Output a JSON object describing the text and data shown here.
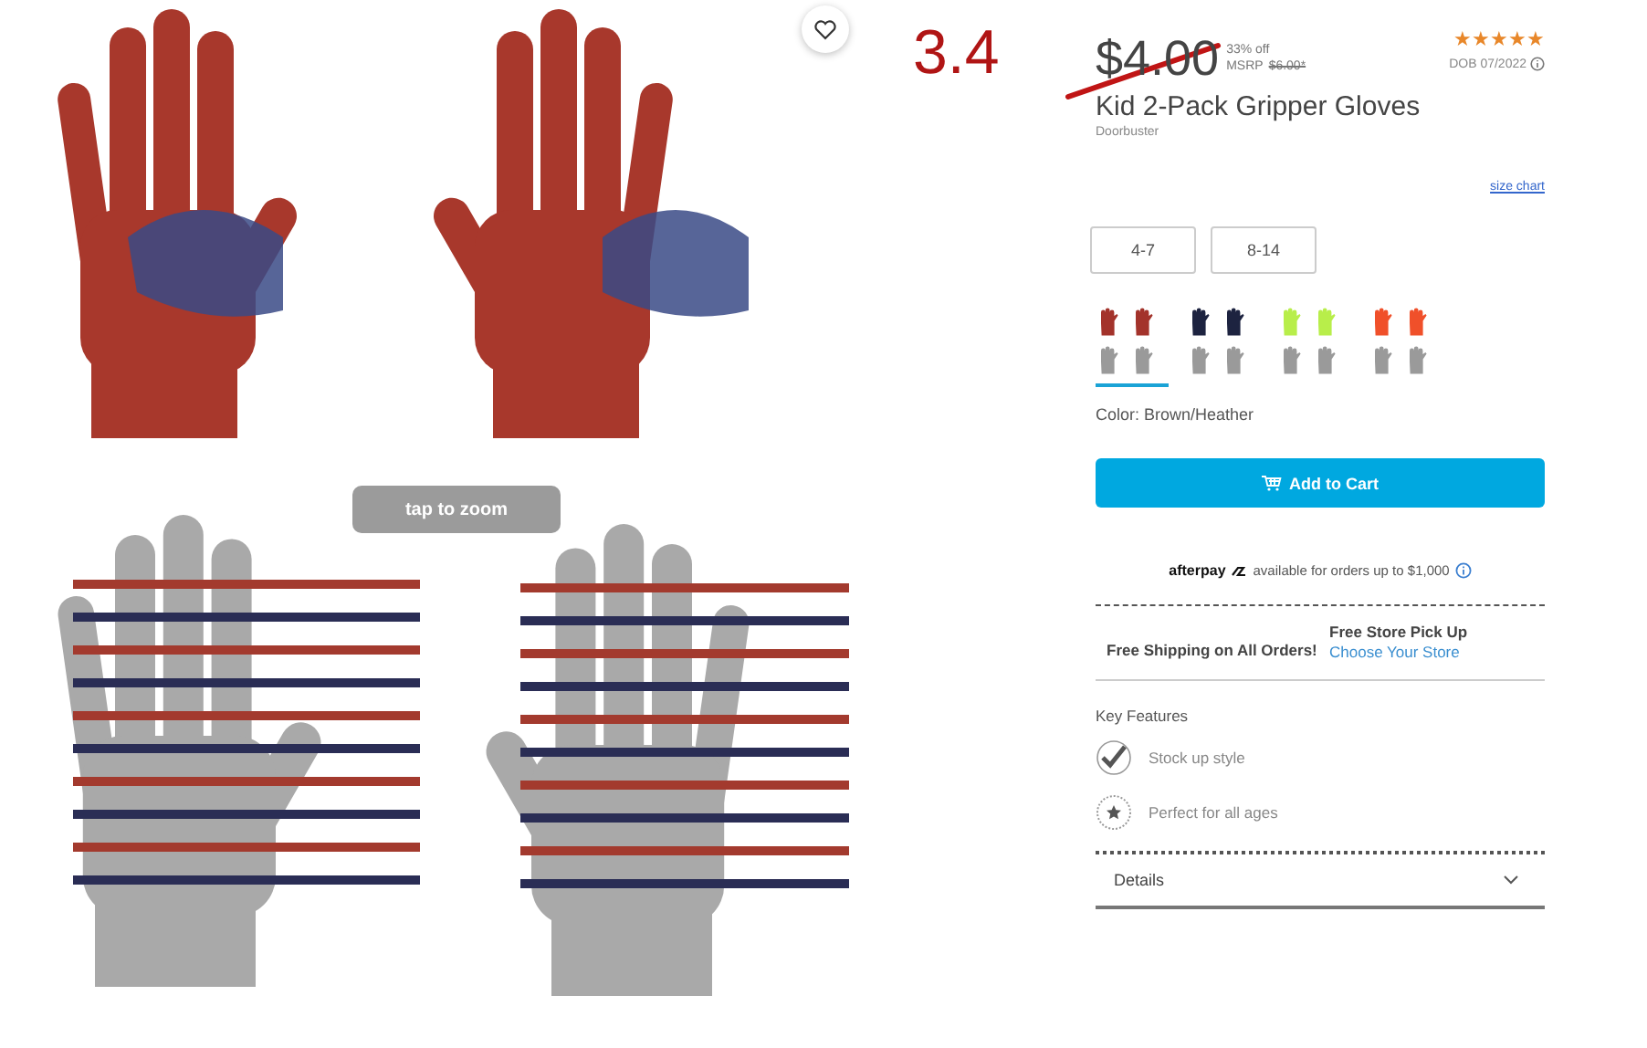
{
  "annotation": {
    "text": "3.4",
    "strike": true
  },
  "gallery": {
    "zoom_hint": "tap to zoom",
    "favorite": false
  },
  "price": {
    "current": "$4.00",
    "discount": "33% off",
    "msrp_label": "MSRP",
    "msrp": "$6.00*"
  },
  "rating": {
    "stars": 5,
    "note": "DOB 07/2022"
  },
  "title": "Kid 2-Pack Gripper Gloves",
  "badge": "Doorbuster",
  "size_chart": "size chart",
  "sizes": [
    {
      "label": "4-7",
      "selected": false
    },
    {
      "label": "8-14",
      "selected": false
    }
  ],
  "swatches": [
    {
      "color": "#a3332b",
      "selected": true
    },
    {
      "color": "#1d2340",
      "selected": false
    },
    {
      "color": "#b8ee4a",
      "selected": false
    },
    {
      "color": "#f0502a",
      "selected": false
    }
  ],
  "color_label": "Color: Brown/Heather",
  "add_to_cart": "Add to Cart",
  "afterpay": {
    "brand": "afterpay",
    "text": "available for orders up to $1,000"
  },
  "shipping": {
    "free_shipping": "Free Shipping on All Orders!",
    "pickup_title": "Free Store Pick Up",
    "pickup_link": "Choose Your Store"
  },
  "key_features": {
    "heading": "Key Features",
    "items": [
      {
        "kind": "check",
        "text": "Stock up style"
      },
      {
        "kind": "star",
        "text": "Perfect for all ages"
      }
    ]
  },
  "details": {
    "label": "Details",
    "expanded": false
  }
}
